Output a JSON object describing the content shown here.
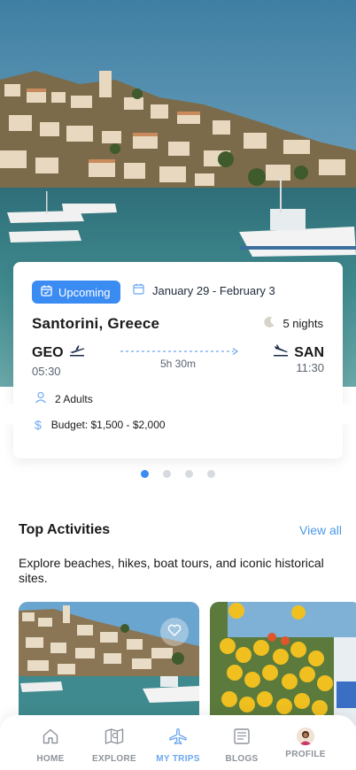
{
  "trip": {
    "status": "Upcoming",
    "dates": "January 29 - February 3",
    "destination": "Santorini, Greece",
    "nights": "5 nights",
    "origin_code": "GEO",
    "origin_time": "05:30",
    "destination_code": "SAN",
    "destination_time": "11:30",
    "duration": "5h 30m",
    "travelers": "2 Adults",
    "budget": "Budget: $1,500 - $2,000"
  },
  "carousel": {
    "count": 4,
    "active_index": 0
  },
  "activities": {
    "title": "Top Activities",
    "view_all": "View all",
    "description": "Explore beaches, hikes, boat tours, and iconic historical sites."
  },
  "nav": {
    "items": [
      {
        "label": "HOME",
        "icon": "home-icon"
      },
      {
        "label": "EXPLORE",
        "icon": "map-icon"
      },
      {
        "label": "MY TRIPS",
        "icon": "plane-icon"
      },
      {
        "label": "BLOGS",
        "icon": "blog-icon"
      },
      {
        "label": "PROFILE",
        "icon": "avatar"
      }
    ],
    "active": "MY TRIPS"
  },
  "colors": {
    "accent": "#3b8cf2",
    "link": "#4c9ae9",
    "nav_inactive": "#8e939b",
    "nav_active": "#6ca7ef"
  }
}
